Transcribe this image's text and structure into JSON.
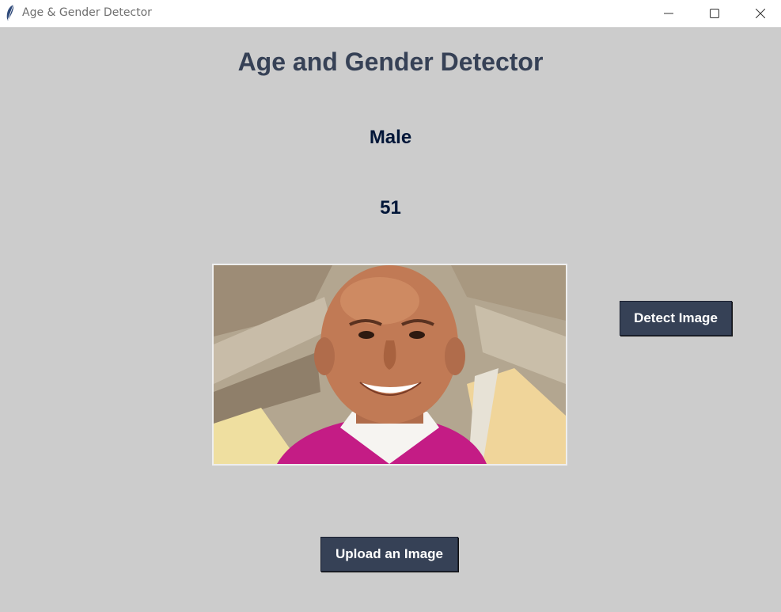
{
  "window": {
    "title": "Age & Gender Detector",
    "icon": "feather-icon"
  },
  "heading": "Age and Gender Detector",
  "result": {
    "gender": "Male",
    "age": "51"
  },
  "buttons": {
    "detect_label": "Detect Image",
    "upload_label": "Upload an Image"
  },
  "colors": {
    "background": "#cccccc",
    "heading": "#364156",
    "result_text": "#011638",
    "button_bg": "#364156",
    "button_text": "#ffffff"
  }
}
